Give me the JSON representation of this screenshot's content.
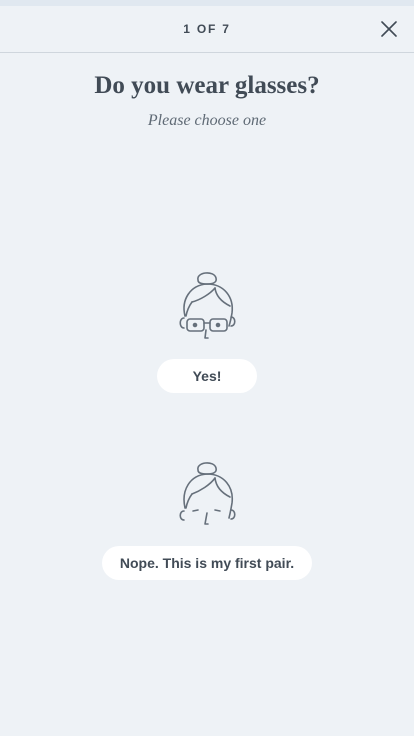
{
  "header": {
    "step_label": "1 OF 7"
  },
  "question": {
    "title": "Do you wear glasses?",
    "subtitle": "Please choose one"
  },
  "options": [
    {
      "label": "Yes!",
      "icon": "face-with-glasses-icon"
    },
    {
      "label": "Nope. This is my first pair.",
      "icon": "face-without-glasses-icon"
    }
  ],
  "colors": {
    "background": "#eef2f6",
    "text": "#414b56",
    "pill": "#ffffff",
    "divider": "#cfd6dd",
    "line_art": "#66707b"
  }
}
